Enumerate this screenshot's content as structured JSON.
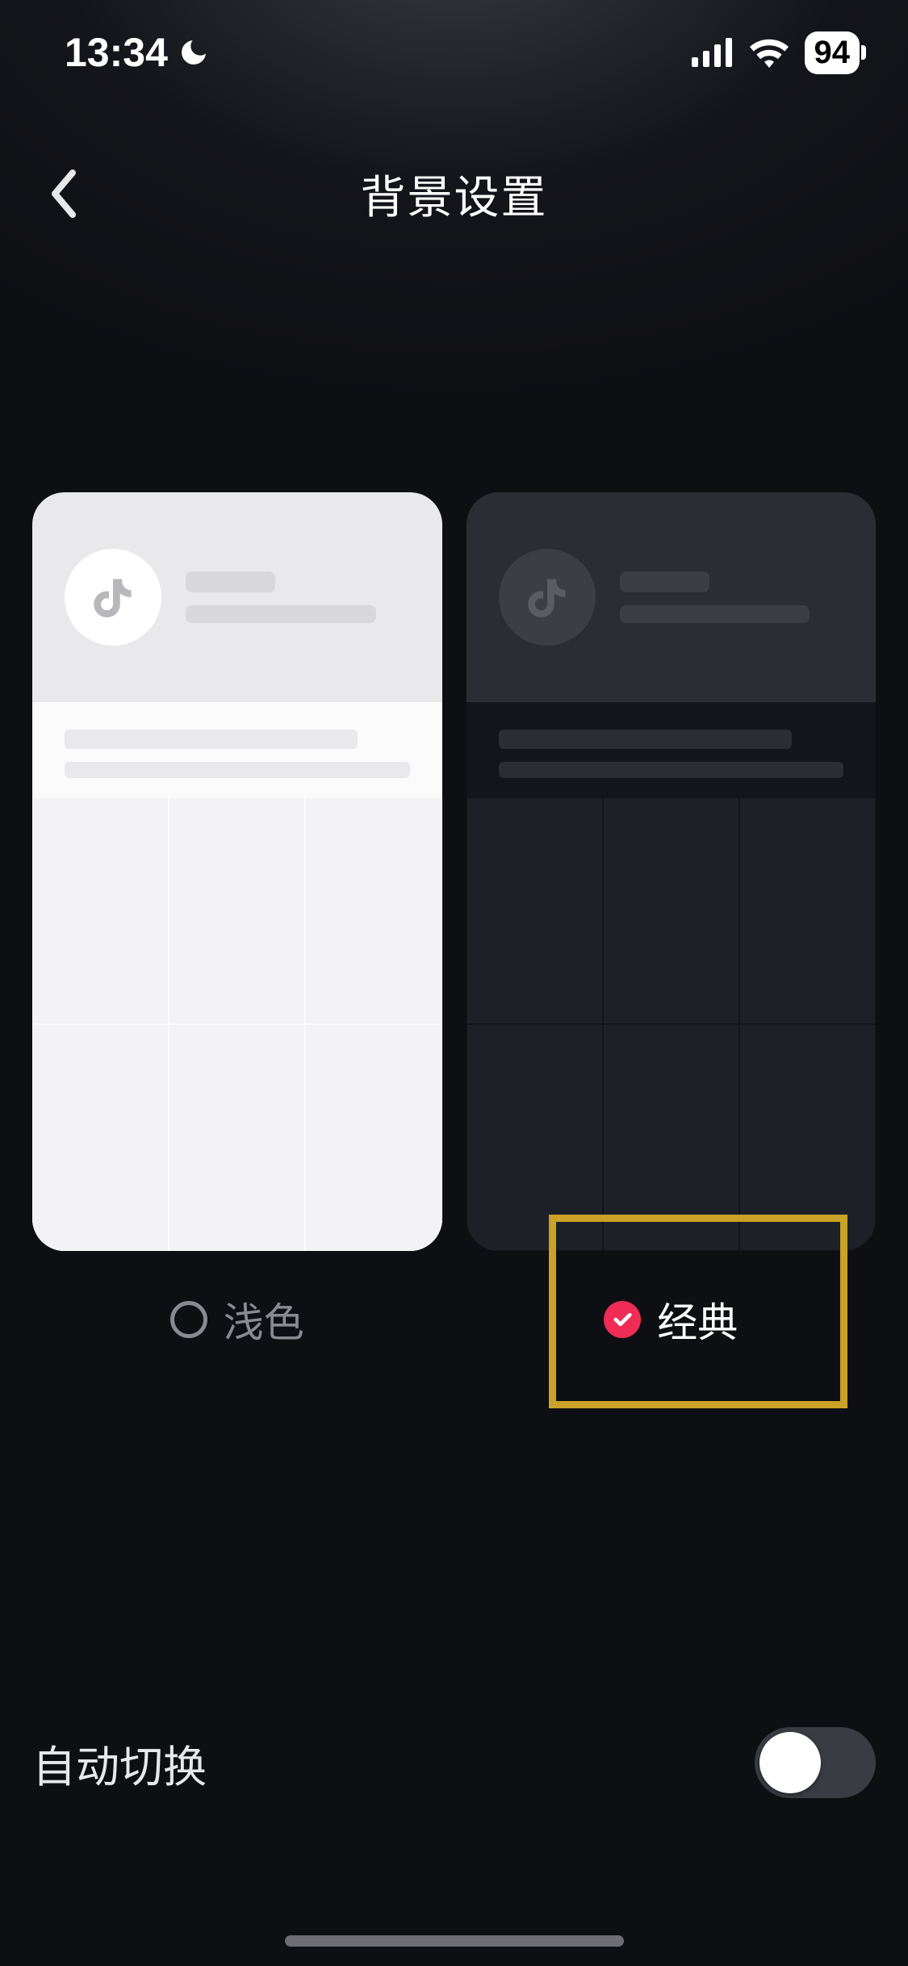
{
  "status": {
    "time": "13:34",
    "battery": "94"
  },
  "nav": {
    "title": "背景设置"
  },
  "themes": {
    "light": {
      "label": "浅色",
      "selected": false
    },
    "dark": {
      "label": "经典",
      "selected": true
    }
  },
  "auto_switch": {
    "label": "自动切换",
    "on": false
  }
}
